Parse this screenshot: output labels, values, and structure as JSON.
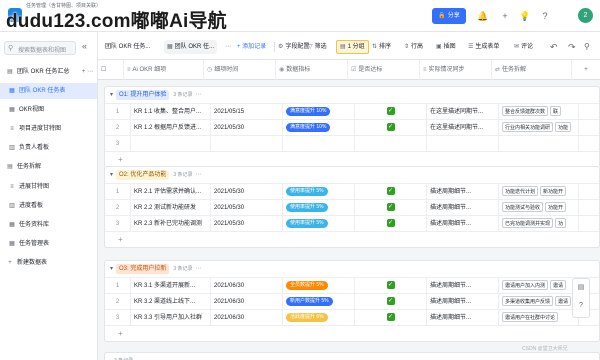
{
  "watermark": "dudu123.com嘟嘟Ai导航",
  "app": {
    "title": "任务管理（含甘特图、项目关联）",
    "subtitle": ""
  },
  "topbar": {
    "share_label": "分享",
    "share_icon": "lock-icon",
    "icons": [
      "bell-icon",
      "plus-icon",
      "lightbulb-icon",
      "help-icon"
    ],
    "avatar_text": "2"
  },
  "sidebar": {
    "search_placeholder": "搜索数据表和视图",
    "items": [
      {
        "label": "团队 OKR 任务汇总",
        "icon": "table-icon",
        "level": 0
      },
      {
        "label": "团队 OKR 任务表",
        "icon": "grid-view-icon",
        "level": 1,
        "active": true
      },
      {
        "label": "OKR视图",
        "icon": "grid-view-icon",
        "level": 1
      },
      {
        "label": "项目进度甘特图",
        "icon": "gantt-icon",
        "level": 1
      },
      {
        "label": "负责人看板",
        "icon": "kanban-icon",
        "level": 1
      },
      {
        "label": "任务拆解",
        "icon": "table-icon",
        "level": 0
      },
      {
        "label": "进展甘特图",
        "icon": "gantt-icon",
        "level": 1
      },
      {
        "label": "进度看板",
        "icon": "kanban-icon",
        "level": 1
      },
      {
        "label": "任务资料库",
        "icon": "grid-view-icon",
        "level": 1
      },
      {
        "label": "任务管理表",
        "icon": "grid-view-icon",
        "level": 1
      },
      {
        "label": "新建数据表",
        "icon": "plus-icon",
        "level": 0
      }
    ]
  },
  "viewbar": {
    "tabs": [
      {
        "label": "团队 OKR 任务...",
        "icon": "grid-view-icon"
      },
      {
        "label": "团队 OKR 任...",
        "icon": "grid-view-icon",
        "active": true
      }
    ],
    "add_view_label": "添加记录",
    "tools": [
      {
        "label": "字段配置",
        "icon": "settings-icon"
      },
      {
        "label": "筛选",
        "icon": "filter-icon"
      },
      {
        "label": "1 分组",
        "icon": "group-icon",
        "on": true
      },
      {
        "label": "排序",
        "icon": "sort-icon"
      },
      {
        "label": "行高",
        "icon": "row-height-icon"
      },
      {
        "label": "插图",
        "icon": "image-icon"
      },
      {
        "label": "生成表单",
        "icon": "form-icon"
      },
      {
        "label": "评论",
        "icon": "comment-icon"
      }
    ]
  },
  "columns": [
    {
      "label": "Ai OKR 细项",
      "icon": "text-icon"
    },
    {
      "label": "细项时间",
      "icon": "date-icon"
    },
    {
      "label": "数据指标",
      "icon": "select-icon"
    },
    {
      "label": "是否达标",
      "icon": "checkbox-icon"
    },
    {
      "label": "实际情况同步",
      "icon": "text-icon"
    },
    {
      "label": "任务拆解",
      "icon": "link-icon"
    }
  ],
  "groups": [
    {
      "name": "O1: 提升用户体验",
      "pill_color": "#e1eaff",
      "pill_text_color": "#245bdb",
      "count": "3 条记录",
      "rows": [
        {
          "idx": "1",
          "kr": "KR 1.1 收集、整合用户...",
          "date": "2021/05/15",
          "metric": "满意度提升 10%",
          "metric_color": "#3370ff",
          "done": true,
          "sync": "在这里描述同期节...",
          "tasks": [
            "整合反馈建群次数",
            "联"
          ]
        },
        {
          "idx": "2",
          "kr": "KR 1.2 根据用户反馈进...",
          "date": "2021/05/30",
          "metric": "满意度提升 10%",
          "metric_color": "#3370ff",
          "done": true,
          "sync": "在这里描述同期节...",
          "tasks": [
            "行业内相关功能调研",
            "功能"
          ]
        },
        {
          "idx": "3",
          "kr": "",
          "date": "",
          "metric": "",
          "metric_color": "",
          "done": false,
          "sync": "",
          "tasks": []
        }
      ]
    },
    {
      "name": "O2: 优化产品功能",
      "pill_color": "#fff3d6",
      "pill_text_color": "#8f5a00",
      "count": "3 条记录",
      "rows": [
        {
          "idx": "1",
          "kr": "KR 2.1 评估需求并确认...",
          "date": "2021/05/30",
          "metric": "使用率提升 5%",
          "metric_color": "#3bb4e8",
          "done": true,
          "sync": "描述周期细节...",
          "tasks": [
            "功能迭代计划",
            "新功能开"
          ]
        },
        {
          "idx": "2",
          "kr": "KR 2.2 测试新功能研发",
          "date": "2021/05/30",
          "metric": "使用率提升 5%",
          "metric_color": "#3bb4e8",
          "done": true,
          "sync": "描述周期细节...",
          "tasks": [
            "功能测试与验收",
            "功能开"
          ]
        },
        {
          "idx": "3",
          "kr": "KR 2.3 新补已完功能调测",
          "date": "2021/05/30",
          "metric": "使用率提升 5%",
          "metric_color": "#3bb4e8",
          "done": true,
          "sync": "描述周期细节...",
          "tasks": [
            "已完功能调测并实现",
            "功"
          ]
        }
      ]
    },
    {
      "name": "O3: 完成用户拉新",
      "pill_color": "#ffe4d6",
      "pill_text_color": "#c45200",
      "count": "3 条记录",
      "rows": [
        {
          "idx": "1",
          "kr": "KR 3.1 多渠道开展新...",
          "date": "2021/06/30",
          "metric": "全员数提升 5%",
          "metric_color": "#ff8800",
          "done": true,
          "sync": "描述周期细节...",
          "tasks": [
            "邀请用户加入内测",
            "邀请"
          ]
        },
        {
          "idx": "2",
          "kr": "KR 3.2 渠道线上线下...",
          "date": "2021/06/30",
          "metric": "新用户数提升 5%",
          "metric_color": "#3370ff",
          "done": true,
          "sync": "描述周期细节...",
          "tasks": [
            "多渠道收集用户反馈",
            "邀请"
          ]
        },
        {
          "idx": "3",
          "kr": "KR 3.3 引导用户加入社群",
          "date": "2021/06/30",
          "metric": "活跃度提升 6%",
          "metric_color": "#f5c343",
          "done": true,
          "sync": "描述周期细节...",
          "tasks": [
            "邀请用户在社群中讨论"
          ]
        }
      ]
    }
  ],
  "footer_group_count": "3 条记录",
  "right_panel_icons": [
    "document-icon",
    "help-icon"
  ],
  "footer_credit": "CSDN @堂卫大师兄"
}
